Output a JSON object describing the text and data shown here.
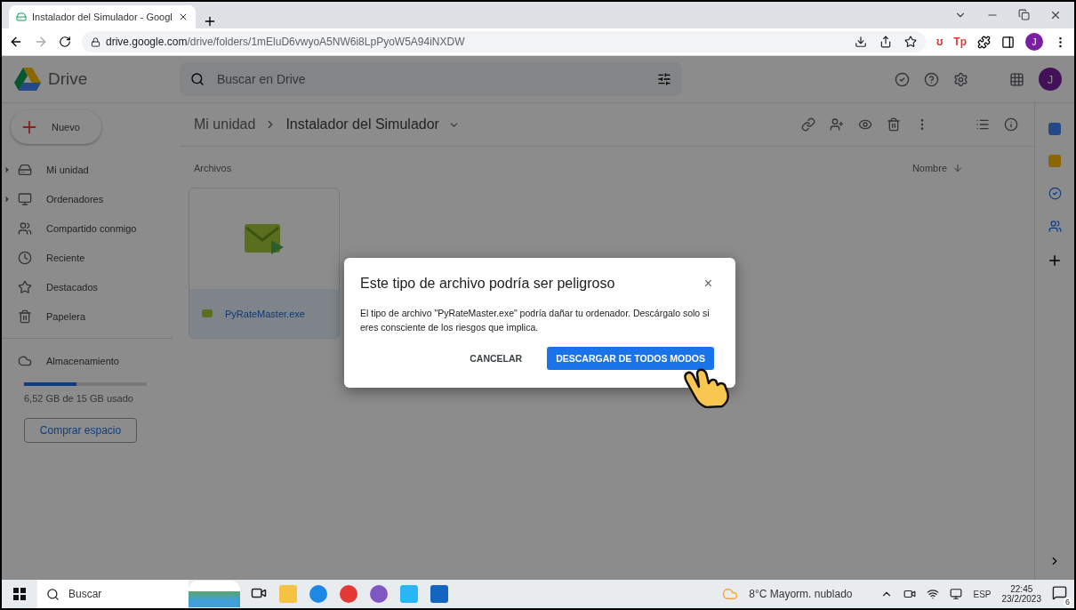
{
  "browser": {
    "tab_title": "Instalador del Simulador - Googl",
    "url_host": "drive.google.com",
    "url_path": "/drive/folders/1mEluD6vwyoA5NW6i8LpPyoW5A94iNXDW",
    "profile_initial": "J",
    "extensions": [
      {
        "label": "ʊ",
        "color": "#d93025"
      },
      {
        "label": "Tp",
        "color": "#e53935"
      }
    ]
  },
  "header": {
    "app_name": "Drive",
    "search_placeholder": "Buscar en Drive",
    "account_initial": "J"
  },
  "new_button": "Nuevo",
  "sidebar": {
    "items": [
      {
        "label": "Mi unidad",
        "expandable": true
      },
      {
        "label": "Ordenadores",
        "expandable": true
      },
      {
        "label": "Compartido conmigo",
        "expandable": false
      },
      {
        "label": "Reciente",
        "expandable": false
      },
      {
        "label": "Destacados",
        "expandable": false
      },
      {
        "label": "Papelera",
        "expandable": false
      }
    ],
    "storage": {
      "label": "Almacenamiento",
      "level": 0.43,
      "usage": "6,52 GB de 15 GB usado",
      "buy_button": "Comprar espacio"
    }
  },
  "breadcrumb": [
    "Mi unidad",
    "Instalador del Simulador"
  ],
  "files": {
    "section": "Archivos",
    "sort": "Nombre",
    "items": [
      {
        "name": "PyRateMaster.exe",
        "selected": true
      }
    ]
  },
  "dialog": {
    "title": "Este tipo de archivo podría ser peligroso",
    "message": "El tipo de archivo \"PyRateMaster.exe\" podría dañar tu ordenador. Descárgalo solo si eres consciente de los riesgos que implica.",
    "close": "×",
    "buttons": [
      {
        "label": "CANCELAR",
        "kind": "text"
      },
      {
        "label": "DESCARGAR DE TODOS MODOS",
        "kind": "primary"
      }
    ]
  },
  "taskbar": {
    "search_placeholder": "Buscar",
    "weather": "8°C  Mayorm. nublado",
    "language": "ESP",
    "time": "22:45",
    "date": "23/2/2023",
    "notifications": "6"
  }
}
